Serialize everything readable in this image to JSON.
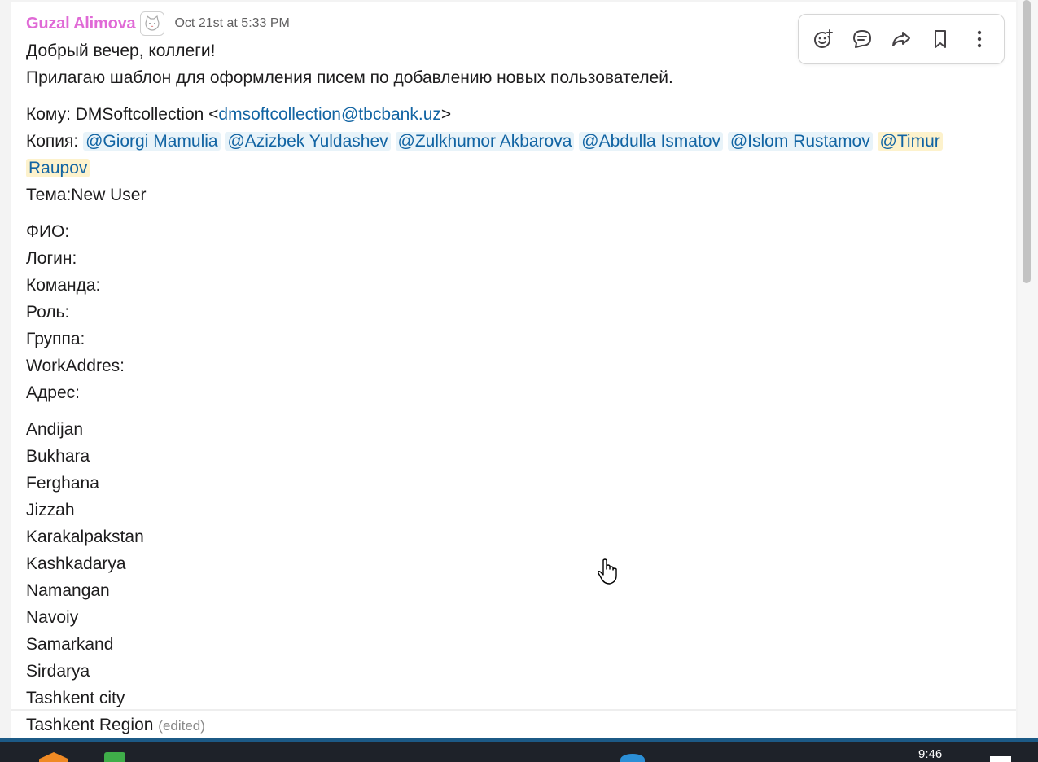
{
  "message": {
    "sender": "Guzal Alimova",
    "timestamp": "Oct 21st at 5:33 PM",
    "greeting": "Добрый вечер, коллеги!",
    "intro": "Прилагаю шаблон для оформления писем по добавлению новых пользователей.",
    "to_label": "Кому: DMSoftcollection <",
    "to_email": "dmsoftcollection@tbcbank.uz",
    "to_close": ">",
    "cc_label": "Копия: ",
    "mentions": [
      "@Giorgi Mamulia",
      "@Azizbek Yuldashev",
      "@Zulkhumor Akbarova",
      "@Abdulla Ismatov",
      "@Islom Rustamov"
    ],
    "self_mention_part1": "@Timur",
    "self_mention_part2": "Raupov",
    "subject": "Тема:New User",
    "fields": [
      "ФИО:",
      "Логин:",
      "Команда:",
      "Роль:",
      "Группа:",
      "WorkAddres:",
      "Адрес:"
    ],
    "regions": [
      "Andijan",
      "Bukhara",
      "Ferghana",
      "Jizzah",
      "Karakalpakstan",
      "Kashkadarya",
      "Namangan",
      "Navoiy",
      "Samarkand",
      "Sirdarya",
      "Tashkent city",
      "Tashkent Region"
    ],
    "edited_label": "(edited)"
  },
  "toolbar": {
    "icons": [
      "add-reaction-icon",
      "reply-in-thread-icon",
      "forward-icon",
      "bookmark-icon",
      "more-actions-icon"
    ]
  },
  "taskbar": {
    "clock": "9:46"
  },
  "colors": {
    "sender": "#e06ad6",
    "link": "#1264a3",
    "mention_bg": "#e8f3f9",
    "self_mention_bg": "#fdf2cc"
  }
}
